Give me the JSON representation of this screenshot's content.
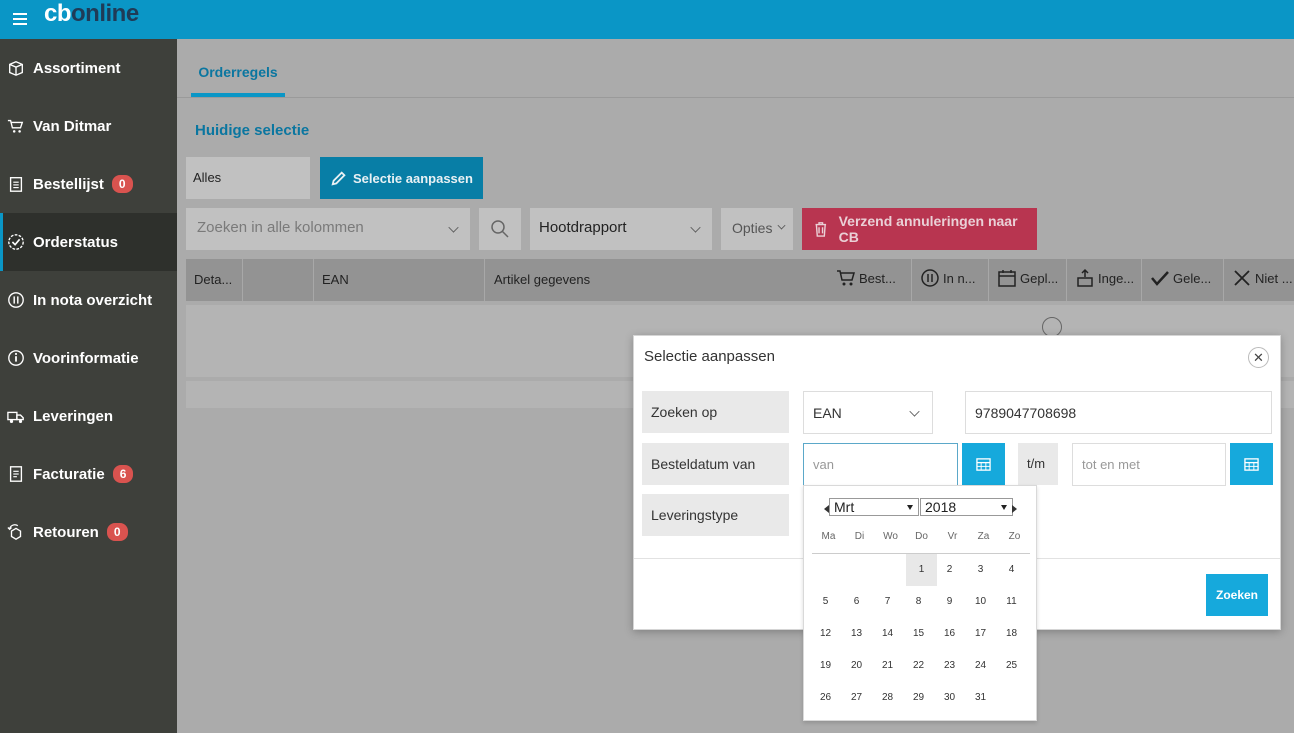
{
  "app": {
    "brand_cb": "cb",
    "brand_online": "online"
  },
  "sidebar": {
    "items": [
      {
        "label": "Assortiment",
        "icon": "box-icon",
        "badge": null
      },
      {
        "label": "Van Ditmar",
        "icon": "cart-icon",
        "badge": null
      },
      {
        "label": "Bestellijst",
        "icon": "clipboard-icon",
        "badge": "0"
      },
      {
        "label": "Orderstatus",
        "icon": "check-circle-icon",
        "badge": null,
        "active": true
      },
      {
        "label": "In nota overzicht",
        "icon": "pause-circle-icon",
        "badge": null
      },
      {
        "label": "Voorinformatie",
        "icon": "info-circle-icon",
        "badge": null
      },
      {
        "label": "Leveringen",
        "icon": "truck-icon",
        "badge": null
      },
      {
        "label": "Facturatie",
        "icon": "invoice-icon",
        "badge": "6"
      },
      {
        "label": "Retouren",
        "icon": "return-box-icon",
        "badge": "0"
      }
    ]
  },
  "main": {
    "tab": "Orderregels",
    "current_selection_heading": "Huidige selectie",
    "selection_value": "Alles",
    "edit_selection_button": "Selectie aanpassen",
    "search_placeholder": "Zoeken in alle kolommen",
    "report_select": "Hootdrapport",
    "options_label": "Opties",
    "send_cancellations_button": "Verzend annuleringen naar CB",
    "columns": [
      "Deta...",
      "EAN",
      "Artikel gegevens",
      "Best...",
      "In n...",
      "Gepl...",
      "Inge...",
      "Gele...",
      "Niet ..."
    ]
  },
  "modal": {
    "title": "Selectie aanpassen",
    "search_on_label": "Zoeken op",
    "search_on_value": "EAN",
    "search_value": "9789047708698",
    "order_date_label": "Besteldatum van",
    "from_placeholder": "van",
    "to_label": "t/m",
    "to_placeholder": "tot en met",
    "delivery_type_label": "Leveringstype",
    "search_button": "Zoeken"
  },
  "datepicker": {
    "month": "Mrt",
    "year": "2018",
    "weekdays": [
      "Ma",
      "Di",
      "Wo",
      "Do",
      "Vr",
      "Za",
      "Zo"
    ],
    "first_weekday_index": 3,
    "days_in_month": 31,
    "highlighted_day": 1
  },
  "colors": {
    "topbar": "#0a96c6",
    "sidebar": "#3e403b",
    "accent": "#16a9dc",
    "danger": "#b83550",
    "badge": "#d9534f"
  }
}
